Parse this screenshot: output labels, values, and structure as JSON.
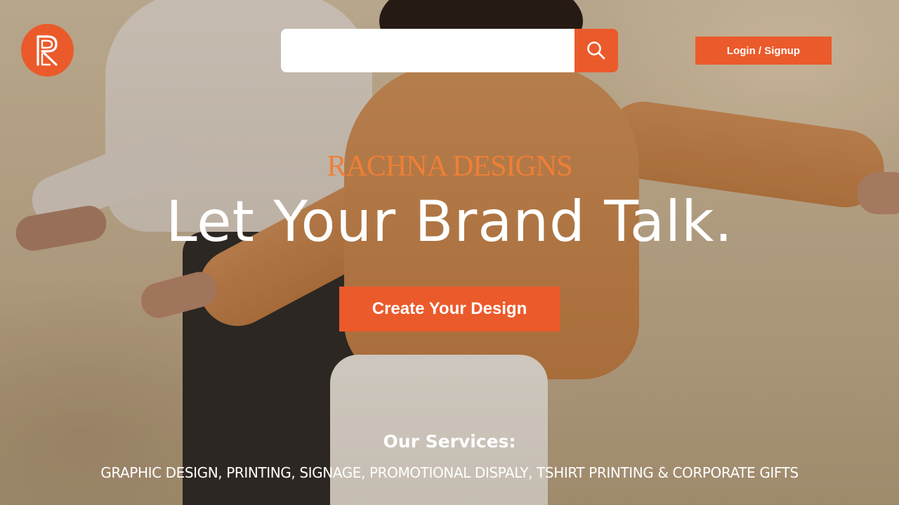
{
  "header": {
    "search": {
      "value": "",
      "placeholder": ""
    },
    "login_label": "Login / Signup"
  },
  "hero": {
    "brand_name": "RACHNA DESIGNS",
    "headline": "Let Your Brand Talk.",
    "cta_label": "Create Your Design"
  },
  "services": {
    "heading": "Our Services:",
    "list": "GRAPHIC DESIGN, PRINTING, SIGNAGE, PROMOTIONAL DISPALY, TSHIRT PRINTING & CORPORATE GIFTS"
  },
  "icons": {
    "logo": "rachna-logo-icon",
    "search": "search-icon"
  },
  "colors": {
    "accent": "#eb5a2b",
    "brand_text": "#f07f36",
    "text_light": "#ffffff"
  }
}
